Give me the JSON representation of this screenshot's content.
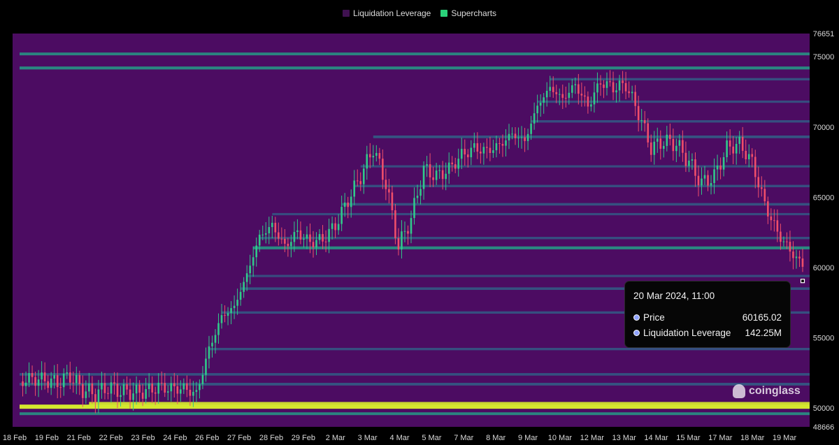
{
  "legend": {
    "items": [
      {
        "label": "Liquidation Leverage",
        "color": "#3f1150"
      },
      {
        "label": "Supercharts",
        "color": "#2ad27a"
      }
    ]
  },
  "colors": {
    "heatmap_base": "#4c0c62",
    "heatmap_low": "#2d6b8c",
    "heatmap_mid": "#22a889",
    "heatmap_high": "#d4e72f",
    "candle_up": "#30c98a",
    "candle_down": "#ef4e6a"
  },
  "tooltip": {
    "title": "20 Mar 2024, 11:00",
    "rows": [
      {
        "label": "Price",
        "value": "60165.02"
      },
      {
        "label": "Liquidation Leverage",
        "value": "142.25M"
      }
    ]
  },
  "watermark": {
    "text": "coinglass",
    "icon": "coinglass-logo-icon"
  },
  "chart_data": {
    "type": "heatmap",
    "xlabel": "",
    "ylabel": "",
    "y_range": [
      48666,
      76651
    ],
    "y_ticks": [
      "76651",
      "75000",
      "70000",
      "65000",
      "60000",
      "55000",
      "50000",
      "48666"
    ],
    "x_ticks": [
      "18 Feb",
      "19 Feb",
      "21 Feb",
      "22 Feb",
      "23 Feb",
      "24 Feb",
      "26 Feb",
      "27 Feb",
      "28 Feb",
      "29 Feb",
      "2 Mar",
      "3 Mar",
      "4 Mar",
      "5 Mar",
      "7 Mar",
      "8 Mar",
      "9 Mar",
      "10 Mar",
      "12 Mar",
      "13 Mar",
      "14 Mar",
      "15 Mar",
      "17 Mar",
      "18 Mar",
      "19 Mar"
    ],
    "price_series": {
      "name": "Supercharts",
      "points": [
        [
          0,
          51900
        ],
        [
          0.5,
          52100
        ],
        [
          1,
          52000
        ],
        [
          1.5,
          51800
        ],
        [
          2,
          52300
        ],
        [
          2.5,
          51300
        ],
        [
          3,
          51000
        ],
        [
          3.5,
          51500
        ],
        [
          4,
          51200
        ],
        [
          4.5,
          51100
        ],
        [
          5,
          51200
        ],
        [
          5.5,
          51500
        ],
        [
          6,
          51400
        ],
        [
          6.5,
          51400
        ],
        [
          7,
          51000
        ],
        [
          7.5,
          54200
        ],
        [
          8,
          56500
        ],
        [
          8.5,
          57200
        ],
        [
          9,
          59500
        ],
        [
          9.5,
          62200
        ],
        [
          10,
          63000
        ],
        [
          10.5,
          61500
        ],
        [
          11,
          62500
        ],
        [
          11.5,
          61800
        ],
        [
          12,
          62000
        ],
        [
          12.5,
          63000
        ],
        [
          13,
          64800
        ],
        [
          13.5,
          66500
        ],
        [
          14,
          68500
        ],
        [
          14.5,
          66000
        ],
        [
          15,
          61500
        ],
        [
          15.5,
          63500
        ],
        [
          16,
          67000
        ],
        [
          16.5,
          66500
        ],
        [
          17,
          67000
        ],
        [
          17.5,
          68000
        ],
        [
          18,
          68500
        ],
        [
          18.5,
          68300
        ],
        [
          19,
          68700
        ],
        [
          19.5,
          69500
        ],
        [
          20,
          69000
        ],
        [
          20.5,
          71500
        ],
        [
          21,
          72800
        ],
        [
          21.5,
          72000
        ],
        [
          22,
          73000
        ],
        [
          22.5,
          71500
        ],
        [
          23,
          73200
        ],
        [
          23.5,
          72800
        ],
        [
          24,
          73000
        ],
        [
          24.5,
          71000
        ],
        [
          25,
          68500
        ],
        [
          25.5,
          69000
        ],
        [
          26,
          68800
        ],
        [
          26.5,
          67500
        ],
        [
          27,
          66000
        ],
        [
          27.5,
          66500
        ],
        [
          28,
          68500
        ],
        [
          28.5,
          68800
        ],
        [
          29,
          67500
        ],
        [
          29.5,
          64500
        ],
        [
          30,
          62500
        ],
        [
          30.5,
          61200
        ],
        [
          31,
          60165
        ]
      ]
    },
    "current_price": 60165.02,
    "liquidation_leverage": "142.25M",
    "liquidation_bands": [
      {
        "price": 50100,
        "intensity": 1.0
      },
      {
        "price": 50300,
        "intensity": 0.85
      },
      {
        "price": 49600,
        "intensity": 0.5
      },
      {
        "price": 51700,
        "intensity": 0.45
      },
      {
        "price": 52400,
        "intensity": 0.4
      },
      {
        "price": 54200,
        "intensity": 0.35
      },
      {
        "price": 56800,
        "intensity": 0.35
      },
      {
        "price": 58500,
        "intensity": 0.4
      },
      {
        "price": 59400,
        "intensity": 0.3
      },
      {
        "price": 61400,
        "intensity": 0.55
      },
      {
        "price": 62100,
        "intensity": 0.35
      },
      {
        "price": 63800,
        "intensity": 0.3
      },
      {
        "price": 64500,
        "intensity": 0.4
      },
      {
        "price": 65800,
        "intensity": 0.35
      },
      {
        "price": 67200,
        "intensity": 0.3
      },
      {
        "price": 69300,
        "intensity": 0.45
      },
      {
        "price": 70400,
        "intensity": 0.35
      },
      {
        "price": 71800,
        "intensity": 0.3
      },
      {
        "price": 73400,
        "intensity": 0.35
      },
      {
        "price": 74200,
        "intensity": 0.55
      },
      {
        "price": 75200,
        "intensity": 0.5
      }
    ]
  }
}
